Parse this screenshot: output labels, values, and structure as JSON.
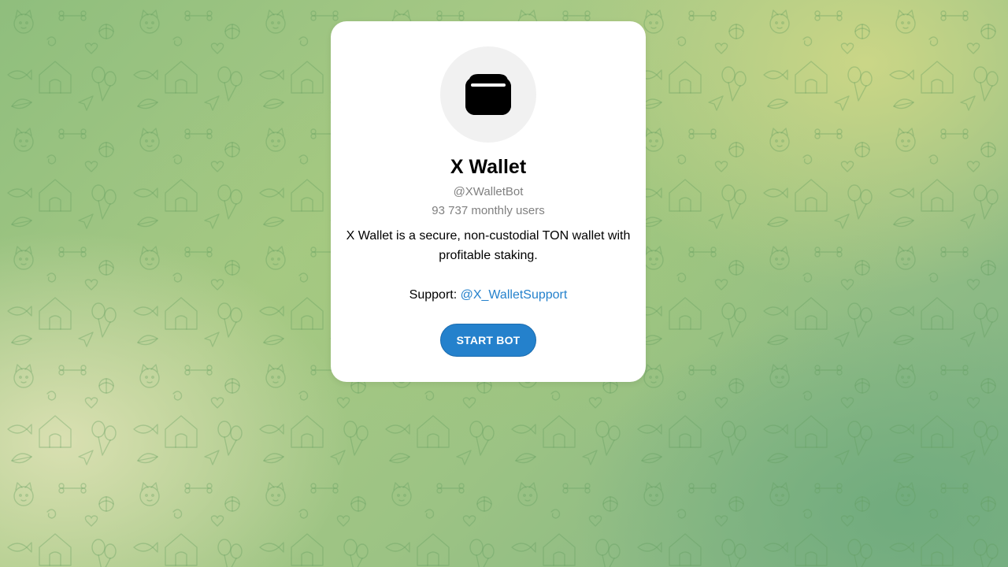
{
  "bot": {
    "name": "X Wallet",
    "username": "@XWalletBot",
    "monthly_users": "93 737 monthly users",
    "description": "X Wallet is a secure, non-custodial TON wallet with profitable staking.",
    "support_label": "Support: ",
    "support_link": "@X_WalletSupport",
    "start_button": "START BOT",
    "avatar_icon": "wallet-icon"
  },
  "colors": {
    "accent": "#2481cc",
    "muted_text": "#808080",
    "card_bg": "#ffffff",
    "background": "#9cc384"
  }
}
